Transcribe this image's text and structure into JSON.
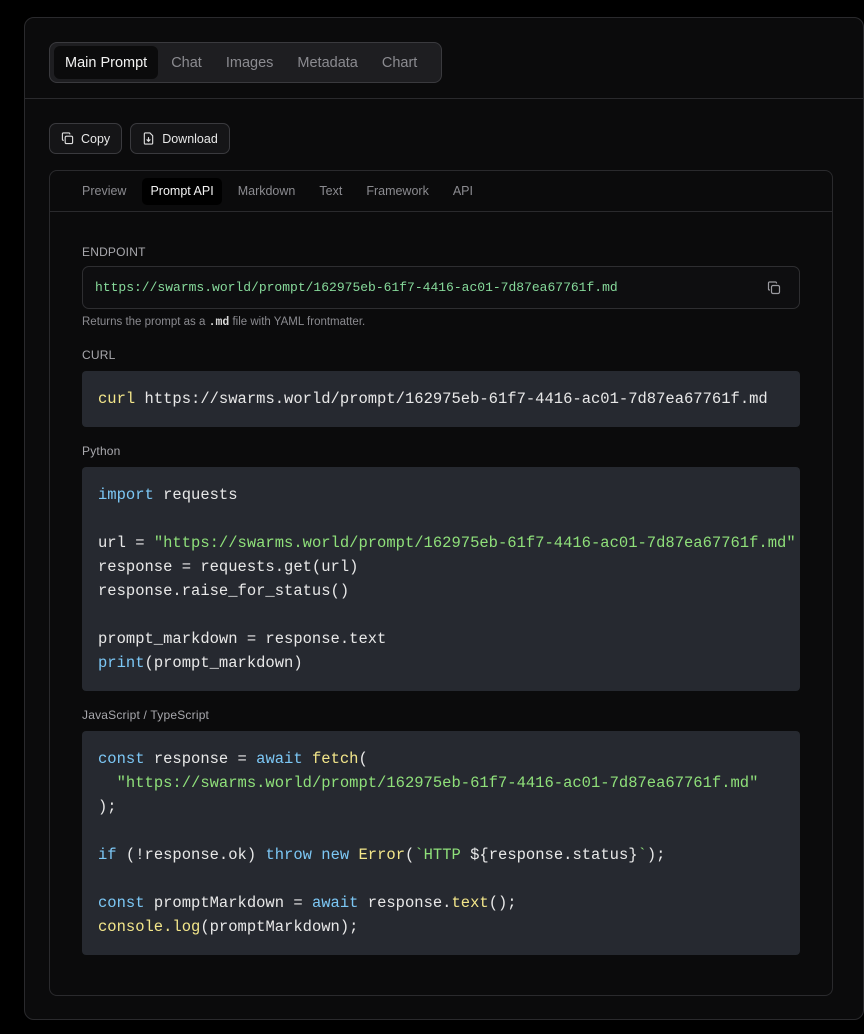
{
  "top_tabs": [
    "Main Prompt",
    "Chat",
    "Images",
    "Metadata",
    "Chart"
  ],
  "actions": {
    "copy_label": "Copy",
    "download_label": "Download"
  },
  "sub_tabs": [
    "Preview",
    "Prompt API",
    "Markdown",
    "Text",
    "Framework",
    "API"
  ],
  "endpoint": {
    "label": "ENDPOINT",
    "url": "https://swarms.world/prompt/162975eb-61f7-4416-ac01-7d87ea67761f.md",
    "hint_prefix": "Returns the prompt as a ",
    "hint_code": ".md",
    "hint_suffix": " file with YAML frontmatter."
  },
  "curl": {
    "label": "CURL",
    "command": "curl",
    "args": " https://swarms.world/prompt/162975eb-61f7-4416-ac01-7d87ea67761f.md"
  },
  "python": {
    "label": "Python",
    "kw_import": "import",
    "l1_rest": " requests",
    "l3_pre": "url = ",
    "l3_str": "\"https://swarms.world/prompt/162975eb-61f7-4416-ac01-7d87ea67761f.md\"",
    "l4": "response = requests.get(url)",
    "l5": "response.raise_for_status()",
    "l7": "prompt_markdown = response.text",
    "kw_print": "print",
    "l8_rest": "(prompt_markdown)"
  },
  "js": {
    "label": "JavaScript / TypeScript",
    "kw_const": "const",
    "l1_mid": " response = ",
    "kw_await": "await",
    "fn_fetch": "fetch",
    "l1_end": "(",
    "l2_indent": "  ",
    "l2_str": "\"https://swarms.world/prompt/162975eb-61f7-4416-ac01-7d87ea67761f.md\"",
    "l3": ");",
    "kw_if": "if",
    "l5_a": " (!response.ok) ",
    "kw_throw": "throw",
    "l5_sp": " ",
    "kw_new": "new",
    "l5_sp2": " ",
    "fn_error": "Error",
    "l5_b": "(",
    "l5_str1": "`HTTP ",
    "l5_tpl": "${response.status}",
    "l5_str2": "`",
    "l5_c": ");",
    "l7_mid": " promptMarkdown = ",
    "l7_rest": " response.",
    "fn_text": "text",
    "l7_end": "();",
    "fn_console": "console.log",
    "l8_rest": "(promptMarkdown);"
  }
}
